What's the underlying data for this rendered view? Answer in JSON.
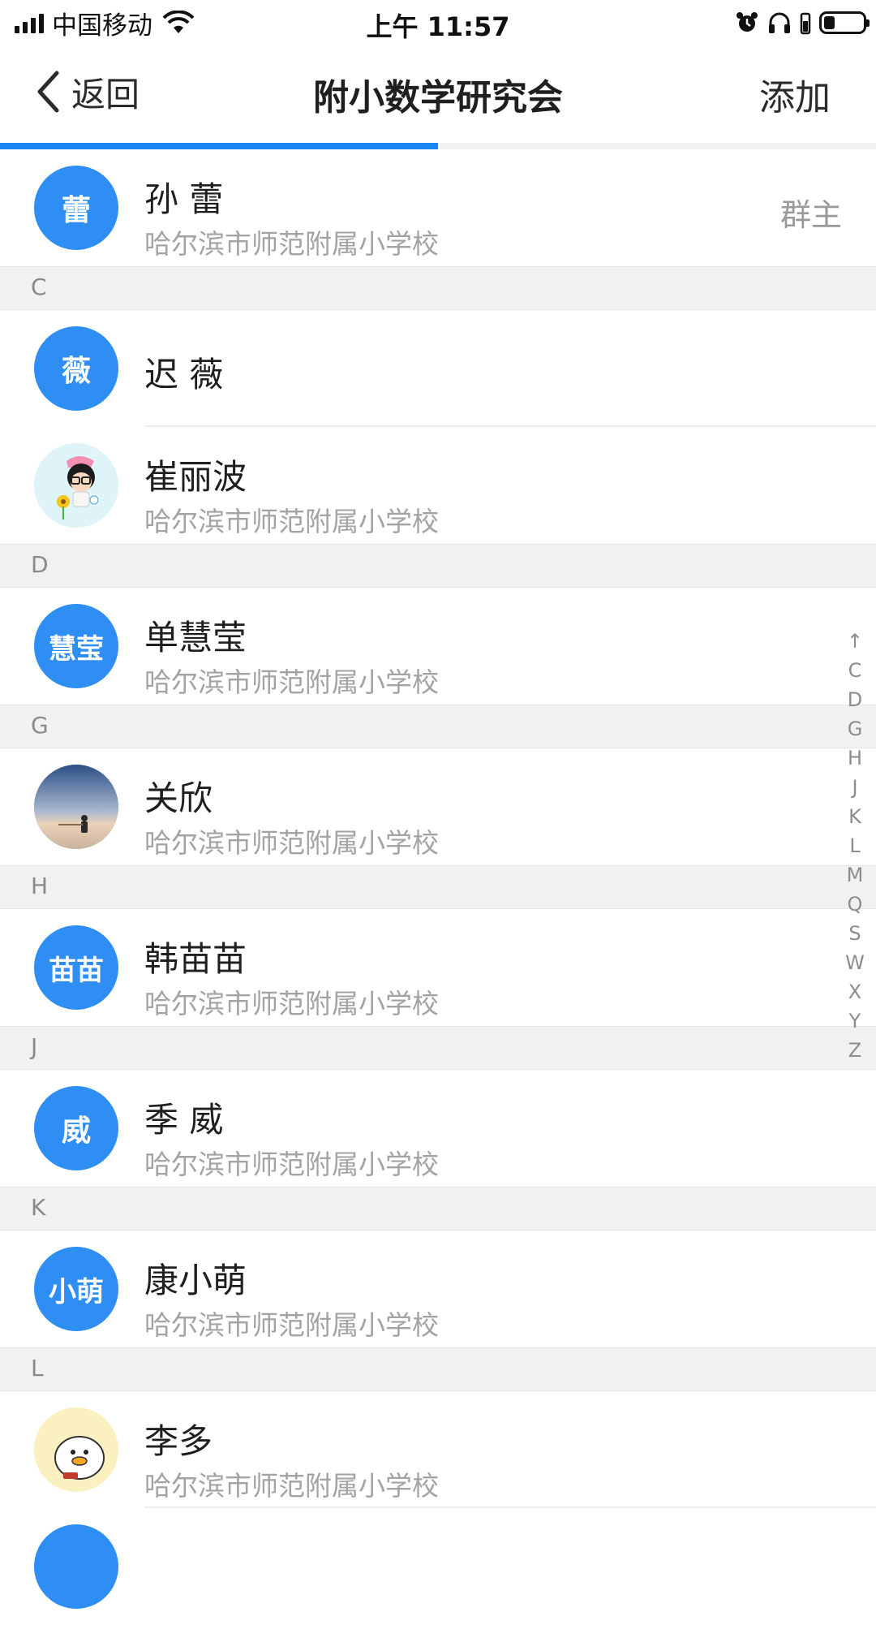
{
  "status_bar": {
    "carrier": "中国移动",
    "time": "上午 11:57"
  },
  "nav": {
    "back_label": "返回",
    "title": "附小数学研究会",
    "action_label": "添加",
    "progress": 0.5,
    "accent_color": "#1b86f3"
  },
  "owner": {
    "avatar_text": "蕾",
    "name": "孙 蕾",
    "org": "哈尔滨市师范附属小学校",
    "role": "群主"
  },
  "sections": [
    {
      "letter": "C",
      "members": [
        {
          "avatar_text": "薇",
          "avatar_type": "text",
          "name": "迟 薇",
          "org": ""
        },
        {
          "avatar_text": "",
          "avatar_type": "photo-cartoon-girl",
          "name": "崔丽波",
          "org": "哈尔滨市师范附属小学校"
        }
      ]
    },
    {
      "letter": "D",
      "members": [
        {
          "avatar_text": "慧莹",
          "avatar_type": "text",
          "name": "单慧莹",
          "org": "哈尔滨市师范附属小学校"
        }
      ]
    },
    {
      "letter": "G",
      "members": [
        {
          "avatar_text": "",
          "avatar_type": "photo-dusk",
          "name": "关欣",
          "org": "哈尔滨市师范附属小学校"
        }
      ]
    },
    {
      "letter": "H",
      "members": [
        {
          "avatar_text": "苗苗",
          "avatar_type": "text",
          "name": "韩苗苗",
          "org": "哈尔滨市师范附属小学校"
        }
      ]
    },
    {
      "letter": "J",
      "members": [
        {
          "avatar_text": "威",
          "avatar_type": "text",
          "name": "季 威",
          "org": "哈尔滨市师范附属小学校"
        }
      ]
    },
    {
      "letter": "K",
      "members": [
        {
          "avatar_text": "小萌",
          "avatar_type": "text",
          "name": "康小萌",
          "org": "哈尔滨市师范附属小学校"
        }
      ]
    },
    {
      "letter": "L",
      "members": [
        {
          "avatar_text": "",
          "avatar_type": "photo-cartoon-duck",
          "name": "李多",
          "org": "哈尔滨市师范附属小学校"
        }
      ]
    }
  ],
  "index_letters": [
    "↑",
    "C",
    "D",
    "G",
    "H",
    "J",
    "K",
    "L",
    "M",
    "Q",
    "S",
    "W",
    "X",
    "Y",
    "Z"
  ]
}
